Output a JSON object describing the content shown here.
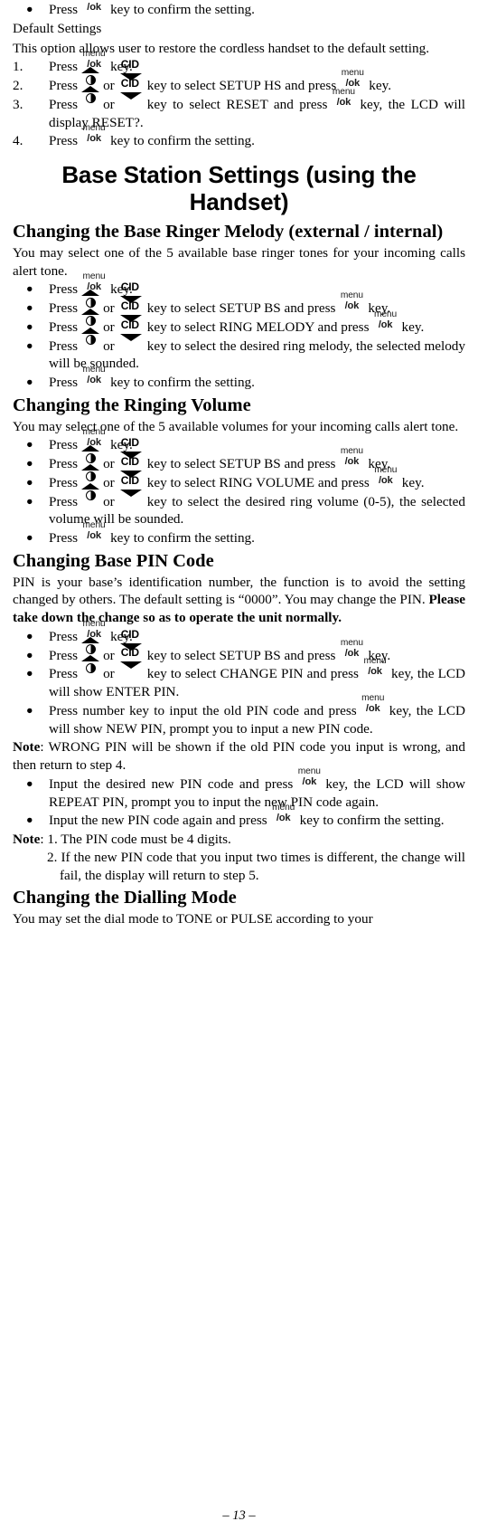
{
  "document": {
    "page_number": "13",
    "footer": "– 13 –"
  },
  "keys": {
    "menu_ok": {
      "top": "menu",
      "bottom": "/ok",
      "name": "menu/ok key"
    },
    "up": {
      "name": "up / redial key"
    },
    "down": {
      "label": "CID",
      "name": "down / CID key"
    }
  },
  "blocks": {
    "b1_bullet_confirm": {
      "bullet": "●",
      "t1": "Press",
      "t2": "key to confirm the setting."
    },
    "h_default_settings": "Default Settings",
    "p_default_intro": "This option allows user to restore the cordless handset to the default setting.",
    "step1": {
      "num": "1.",
      "t1": "Press",
      "t2": "key."
    },
    "step2": {
      "num": "2.",
      "t1": "Press",
      "t_or": "or",
      "t2": "key to select SETUP HS and press",
      "t3": "key."
    },
    "step3": {
      "num": "3.",
      "t1": "Press",
      "t_or": "or",
      "t2": "key to select RESET and press",
      "t3": "key, the LCD will display RESET?."
    },
    "step4": {
      "num": "4.",
      "t1": "Press",
      "t2": "key to confirm the setting."
    },
    "h1_base_station": "Base Station Settings (using the Handset)",
    "h2_ringer_melody": "Changing the Base Ringer Melody (external / internal)",
    "p_melody_intro": "You may select one of the 5 available base ringer tones for your incoming calls alert tone.",
    "melody_b1": {
      "bullet": "●",
      "t1": "Press",
      "t2": "key."
    },
    "melody_b2": {
      "bullet": "●",
      "t1": "Press",
      "t_or": "or",
      "t2": "key to select SETUP BS and press",
      "t3": "key."
    },
    "melody_b3": {
      "bullet": "●",
      "t1": "Press",
      "t_or": "or",
      "t2": "key to select RING MELODY and press",
      "t3": "key."
    },
    "melody_b4": {
      "bullet": "●",
      "t1": "Press",
      "t_or": "or",
      "t2": "key to select the desired ring melody, the selected melody will be sounded."
    },
    "melody_b5": {
      "bullet": "●",
      "t1": "Press",
      "t2": "key to confirm the setting."
    },
    "h2_ringing_volume": "Changing the Ringing Volume",
    "p_volume_intro": "You may select one of the 5 available volumes for your incoming calls alert tone.",
    "vol_b1": {
      "bullet": "●",
      "t1": "Press",
      "t2": "key."
    },
    "vol_b2": {
      "bullet": "●",
      "t1": "Press",
      "t_or": "or",
      "t2": "key to select SETUP BS and press",
      "t3": "key."
    },
    "vol_b3": {
      "bullet": "●",
      "t1": "Press",
      "t_or": "or",
      "t2": "key to select RING VOLUME and press",
      "t3": "key."
    },
    "vol_b4": {
      "bullet": "●",
      "t1": "Press",
      "t_or": "or",
      "t2": "key to select the desired ring volume (0-5), the selected volume will be sounded."
    },
    "vol_b5": {
      "bullet": "●",
      "t1": "Press",
      "t2": "key to confirm the setting."
    },
    "h2_base_pin": "Changing Base PIN Code",
    "p_pin_intro_a": "PIN is your base’s identification number, the function is to avoid the setting changed by others. The default setting is “0000”. You may change the PIN. ",
    "p_pin_intro_b": "Please take down the change so as to operate the unit normally.",
    "pin_b1": {
      "bullet": "●",
      "t1": "Press",
      "t2": "key."
    },
    "pin_b2": {
      "bullet": "●",
      "t1": "Press",
      "t_or": "or",
      "t2": "key to select SETUP BS and press",
      "t3": "key."
    },
    "pin_b3": {
      "bullet": "●",
      "t1": "Press",
      "t_or": "or",
      "t2": "key to select CHANGE PIN and press",
      "t3": "key, the LCD will show ENTER PIN."
    },
    "pin_b4": {
      "bullet": "●",
      "t1": "Press number key to input the old PIN code and press",
      "t2": "key, the LCD will show NEW PIN, prompt you to input a new PIN code."
    },
    "note1": {
      "label": "Note",
      "text": ": WRONG PIN will be shown if the old PIN code you input is wrong, and then return to step 4."
    },
    "pin_b5": {
      "bullet": "●",
      "t1": "Input the desired new PIN code and press",
      "t2": "key, the LCD will show REPEAT PIN, prompt you to input the new PIN code again."
    },
    "pin_b6": {
      "bullet": "●",
      "t1": "Input the new PIN code again and press",
      "t2": "key to confirm the setting."
    },
    "note2": {
      "label": "Note",
      "text": ": 1. The PIN code must be 4 digits."
    },
    "note2_sub": "2. If the new PIN code that you input two times is different, the change will fail, the display will return to step 5.",
    "h2_dialling_mode": "Changing the Dialling Mode",
    "p_dialling_intro": "You may set the dial mode to TONE or PULSE according to your"
  }
}
